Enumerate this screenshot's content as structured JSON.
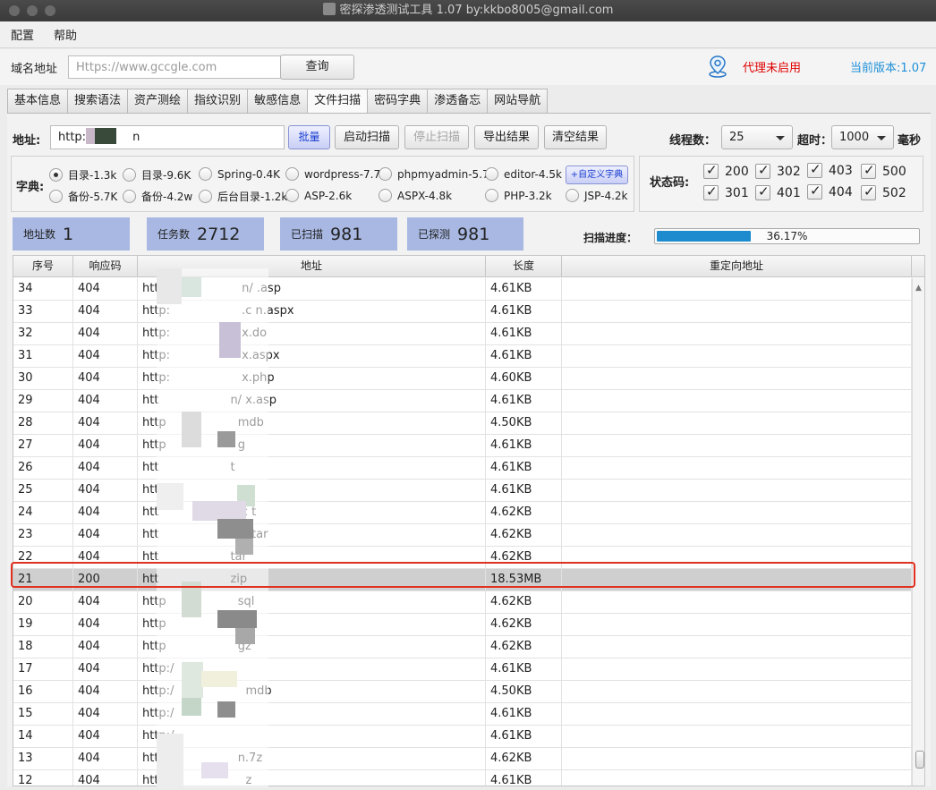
{
  "window": {
    "title": "密探渗透测试工具 1.07 by:kkbo8005@gmail.com"
  },
  "menu": [
    "配置",
    "帮助"
  ],
  "domain": {
    "label": "域名地址",
    "placeholder": "Https://www.gccgle.com",
    "query_label": "查询"
  },
  "proxy_status": "代理未启用",
  "version_text": "当前版本:1.07",
  "tabs": [
    "基本信息",
    "搜索语法",
    "资产测绘",
    "指纹识别",
    "敏感信息",
    "文件扫描",
    "密码字典",
    "渗透备忘",
    "网站导航"
  ],
  "active_tab": "文件扫描",
  "scan": {
    "address_label": "地址:",
    "address_value": "http:",
    "address_value_tail": "n",
    "batch_label": "批量",
    "start_label": "启动扫描",
    "stop_label": "停止扫描",
    "export_label": "导出结果",
    "clear_label": "清空结果",
    "threads_label": "线程数：",
    "threads_value": "25",
    "timeout_label": "超时：",
    "timeout_value": "1000",
    "ms_label": "毫秒"
  },
  "dict": {
    "label": "字典:",
    "custom_label": "+自定义字典",
    "options": [
      {
        "label": "目录-1.3k",
        "selected": true
      },
      {
        "label": "目录-9.6K",
        "selected": false
      },
      {
        "label": "Spring-0.4K",
        "selected": false
      },
      {
        "label": "wordpress-7.7k",
        "selected": false
      },
      {
        "label": "phpmyadmin-5.7k",
        "selected": false
      },
      {
        "label": "editor-4.5k",
        "selected": false
      },
      {
        "label": "备份-5.7K",
        "selected": false
      },
      {
        "label": "备份-4.2w",
        "selected": false
      },
      {
        "label": "后台目录-1.2k",
        "selected": false
      },
      {
        "label": "ASP-2.6k",
        "selected": false
      },
      {
        "label": "ASPX-4.8k",
        "selected": false
      },
      {
        "label": "PHP-3.2k",
        "selected": false
      },
      {
        "label": "JSP-4.2k",
        "selected": false
      }
    ]
  },
  "status_codes": {
    "label": "状态码:",
    "codes": [
      {
        "code": "200",
        "checked": true
      },
      {
        "code": "302",
        "checked": true
      },
      {
        "code": "403",
        "checked": true
      },
      {
        "code": "500",
        "checked": true
      },
      {
        "code": "301",
        "checked": true
      },
      {
        "code": "401",
        "checked": true
      },
      {
        "code": "404",
        "checked": true
      },
      {
        "code": "502",
        "checked": true
      }
    ]
  },
  "stats": {
    "address_count": {
      "label": "地址数",
      "value": "1"
    },
    "task_count": {
      "label": "任务数",
      "value": "2712"
    },
    "scanned": {
      "label": "已扫描",
      "value": "981"
    },
    "detected": {
      "label": "已探测",
      "value": "981"
    }
  },
  "progress": {
    "label": "扫描进度：",
    "percent": 36.17,
    "text": "36.17%"
  },
  "table": {
    "columns": [
      "序号",
      "响应码",
      "地址",
      "长度",
      "重定向地址"
    ],
    "highlight_row": "21",
    "rows": [
      {
        "id": "34",
        "code": "404",
        "url": "http:",
        "url_tail": "n/   .asp",
        "size": "4.61KB",
        "redirect": ""
      },
      {
        "id": "33",
        "code": "404",
        "url": "http:",
        "url_tail": ".c     n.aspx",
        "size": "4.61KB",
        "redirect": ""
      },
      {
        "id": "32",
        "code": "404",
        "url": "http:",
        "url_tail": "x.do",
        "size": "4.61KB",
        "redirect": ""
      },
      {
        "id": "31",
        "code": "404",
        "url": "http:",
        "url_tail": "x.aspx",
        "size": "4.61KB",
        "redirect": ""
      },
      {
        "id": "30",
        "code": "404",
        "url": "http:",
        "url_tail": "x.php",
        "size": "4.60KB",
        "redirect": ""
      },
      {
        "id": "29",
        "code": "404",
        "url": "htt",
        "url_tail": "n/   x.asp",
        "size": "4.61KB",
        "redirect": ""
      },
      {
        "id": "28",
        "code": "404",
        "url": "http",
        "url_tail": "mdb",
        "size": "4.50KB",
        "redirect": ""
      },
      {
        "id": "27",
        "code": "404",
        "url": "http",
        "url_tail": "g",
        "size": "4.61KB",
        "redirect": ""
      },
      {
        "id": "26",
        "code": "404",
        "url": "htt",
        "url_tail": "t",
        "size": "4.61KB",
        "redirect": ""
      },
      {
        "id": "25",
        "code": "404",
        "url": "htt",
        "url_tail": "",
        "size": "4.61KB",
        "redirect": ""
      },
      {
        "id": "24",
        "code": "404",
        "url": "htt",
        "url_tail": "n.c       t",
        "size": "4.62KB",
        "redirect": ""
      },
      {
        "id": "23",
        "code": "404",
        "url": "htt",
        "url_tail": "n.c      tar",
        "size": "4.62KB",
        "redirect": ""
      },
      {
        "id": "22",
        "code": "404",
        "url": "htt",
        "url_tail": "tar",
        "size": "4.62KB",
        "redirect": ""
      },
      {
        "id": "21",
        "code": "200",
        "url": "htt",
        "url_tail": "zip",
        "size": "18.53MB",
        "redirect": ""
      },
      {
        "id": "20",
        "code": "404",
        "url": "http",
        "url_tail": "sql",
        "size": "4.62KB",
        "redirect": ""
      },
      {
        "id": "19",
        "code": "404",
        "url": "http",
        "url_tail": "xt",
        "size": "4.62KB",
        "redirect": ""
      },
      {
        "id": "18",
        "code": "404",
        "url": "http",
        "url_tail": "gz",
        "size": "4.62KB",
        "redirect": ""
      },
      {
        "id": "17",
        "code": "404",
        "url": "http:/",
        "url_tail": "",
        "size": "4.61KB",
        "redirect": ""
      },
      {
        "id": "16",
        "code": "404",
        "url": "http:/",
        "url_tail": "mdb",
        "size": "4.50KB",
        "redirect": ""
      },
      {
        "id": "15",
        "code": "404",
        "url": "http:/",
        "url_tail": "",
        "size": "4.61KB",
        "redirect": ""
      },
      {
        "id": "14",
        "code": "404",
        "url": "http:/",
        "url_tail": "",
        "size": "4.61KB",
        "redirect": ""
      },
      {
        "id": "13",
        "code": "404",
        "url": "http",
        "url_tail": "n.7z",
        "size": "4.62KB",
        "redirect": ""
      },
      {
        "id": "12",
        "code": "404",
        "url": "http:/",
        "url_tail": "z",
        "size": "4.61KB",
        "redirect": ""
      }
    ]
  },
  "icons": {
    "proxy": "location-pin-icon"
  },
  "colors": {
    "proxy_status": "#e00000",
    "version": "#1d8fd8",
    "stat_card": "#a8b8e2",
    "progress_fill": "#1e8bcf",
    "highlight_border": "#e03020"
  }
}
